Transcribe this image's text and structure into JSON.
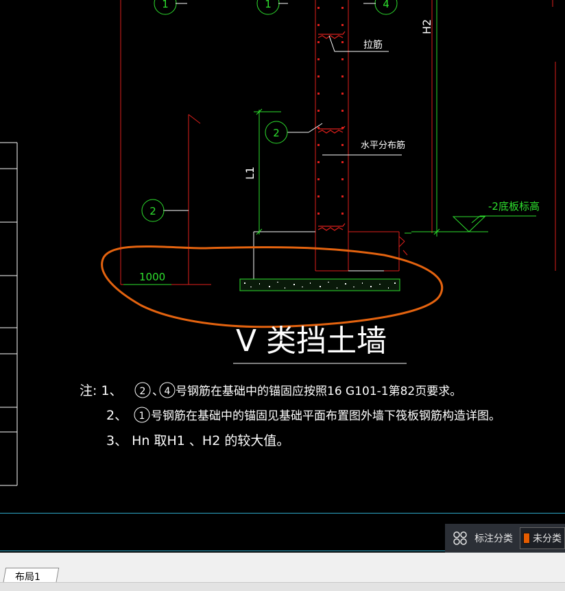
{
  "drawing": {
    "title": "V 类挡土墙",
    "labels": {
      "tie_bar": "拉筋",
      "horizontal_bar": "水平分布筋",
      "bottom_slab_elevation": "-2底板标高",
      "h2": "H2",
      "l1": "L1",
      "dim_1000": "1000"
    },
    "callouts": {
      "c1a": "1",
      "c1b": "1",
      "c4": "4",
      "c2a": "2",
      "c2b": "2"
    },
    "notes": {
      "line1": {
        "prefix": "注: 1、",
        "circle_a": "2",
        "separator": "、",
        "circle_b": "4",
        "text": "号钢筋在基础中的锚固应按照16 G101-1第82页要求。"
      },
      "line2": {
        "prefix": "2、",
        "circle": "1",
        "text": "号钢筋在基础中的锚固见基础平面布置图外墙下筏板钢筋构造详图。"
      },
      "line3": {
        "text": "3、 Hn  取H1 、H2  的较大值。"
      }
    }
  },
  "annotation_panel": {
    "label": "标注分类",
    "unclassified_label": "未分类",
    "swatch_color": "#e65c00"
  },
  "tabs": {
    "layout1": "布局1"
  },
  "colors": {
    "red": "#e0201c",
    "green": "#2ee02e",
    "white": "#ffffff",
    "highlight_orange": "#e4630f",
    "cyan": "#2fa7c8"
  }
}
